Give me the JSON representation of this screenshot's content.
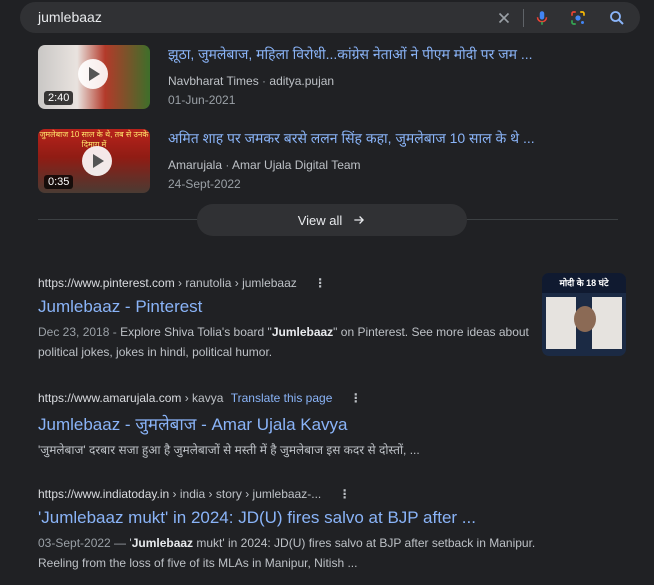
{
  "search": {
    "query": "jumlebaaz"
  },
  "videos": [
    {
      "title": "झूठा, जुमलेबाज, महिला विरोधी...कांग्रेस नेताओं ने पीएम मोदी पर जम ...",
      "source": "Navbharat Times",
      "author": "aditya.pujan",
      "date": "01-Jun-2021",
      "duration": "2:40"
    },
    {
      "title": "अमित शाह पर जमकर बरसे ललन सिंह कहा, जुमलेबाज 10 साल के थे ...",
      "source": "Amarujala",
      "author": "Amar Ujala Digital Team",
      "date": "24-Sept-2022",
      "duration": "0:35",
      "thumb_caption": "जुमलेबाज 10 साल के थे, तब से उनके दिमाग में"
    }
  ],
  "view_all": {
    "label": "View all"
  },
  "results": [
    {
      "domain": "https://www.pinterest.com",
      "path": " › ranutolia › jumlebaaz",
      "title": "Jumlebaaz - Pinterest",
      "snippet_date": "Dec 23, 2018 - ",
      "snippet_a": "Explore Shiva Tolia's board \"",
      "snippet_bold": "Jumlebaaz",
      "snippet_b": "\" on Pinterest. See more ideas about political jokes, jokes in hindi, political humor.",
      "thumb_caption": "मोदी के 18 घंटे"
    },
    {
      "domain": "https://www.amarujala.com",
      "path": " › kavya",
      "translate": "Translate this page",
      "title": "Jumlebaaz - जुमलेबाज - Amar Ujala Kavya",
      "snippet": "'जुमलेबाज' दरबार सजा हुआ है जुमलेबाजों से मस्ती में है जुमलेबाज इस कदर से दोस्तों, ..."
    },
    {
      "domain": "https://www.indiatoday.in",
      "path": " › india › story › jumlebaaz-...",
      "title": "'Jumlebaaz mukt' in 2024: JD(U) fires salvo at BJP after ...",
      "snippet_date": "03-Sept-2022 — ",
      "snippet_a": "'",
      "snippet_bold": "Jumlebaaz",
      "snippet_b": " mukt' in 2024: JD(U) fires salvo at BJP after setback in Manipur. Reeling from the loss of five of its MLAs in Manipur, Nitish ..."
    }
  ],
  "colors": {
    "background": "#202124",
    "link": "#8ab4f8",
    "text": "#bdc1c6",
    "search_box": "#303134"
  }
}
